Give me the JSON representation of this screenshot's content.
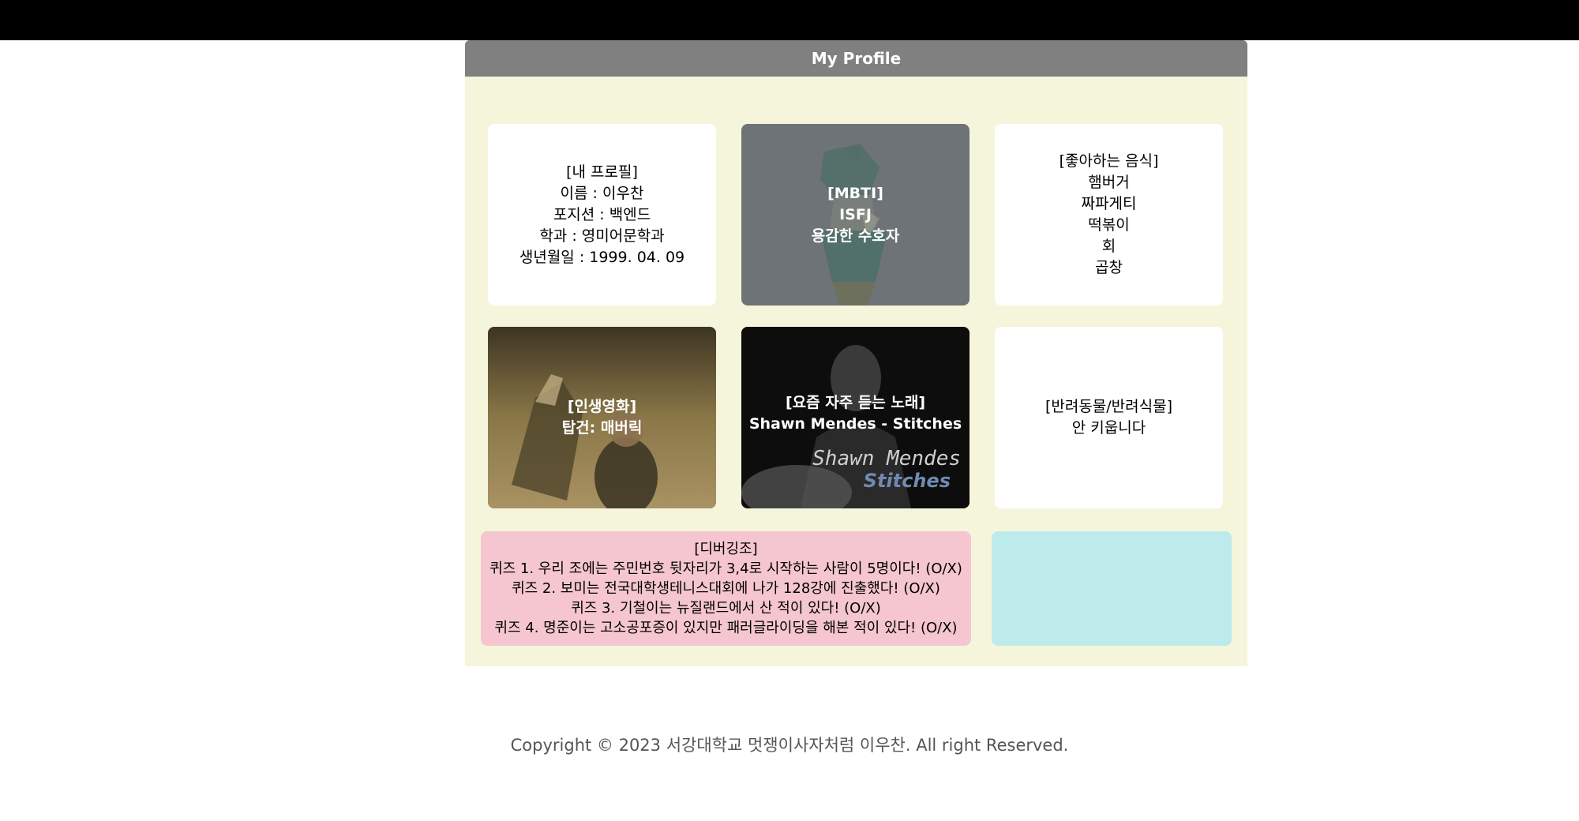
{
  "header": {
    "title": "My Profile"
  },
  "cards": {
    "profile": "[내 프로필]\n이름 : 이우찬\n포지션 : 백엔드\n학과 : 영미어문학과\n생년월일 : 1999. 04. 09",
    "mbti": "[MBTI]\nISFJ\n용감한 수호자",
    "food": "[좋아하는 음식]\n햄버거\n짜파게티\n떡볶이\n회\n곱창",
    "movie": "[인생영화]\n탑건: 매버릭",
    "song": "[요즘 자주 듣는 노래]\nShawn Mendes - Stitches",
    "song_art_artist": "Shawn Mendes",
    "song_art_title": "Stitches",
    "pet": "[반려동물/반려식물]\n안 키웁니다"
  },
  "quiz": {
    "text": "[디버깅조]\n퀴즈 1. 우리 조에는 주민번호 뒷자리가 3,4로 시작하는 사람이 5명이다! (O/X)\n퀴즈 2. 보미는 전국대학생테니스대회에 나가 128강에 진출했다! (O/X)\n퀴즈 3. 기철이는 뉴질랜드에서 산 적이 있다! (O/X)\n퀴즈 4. 명준이는 고소공포증이 있지만 패러글라이딩을 해본 적이 있다! (O/X)"
  },
  "footer": {
    "copyright": "Copyright © 2023 서강대학교 멋쟁이사자처럼 이우찬. All right Reserved."
  },
  "colors": {
    "header_bg": "#808080",
    "panel_bg": "#f5f5dc",
    "quiz_bg": "#f5c6cf",
    "empty_box_bg": "#bdebeb"
  }
}
